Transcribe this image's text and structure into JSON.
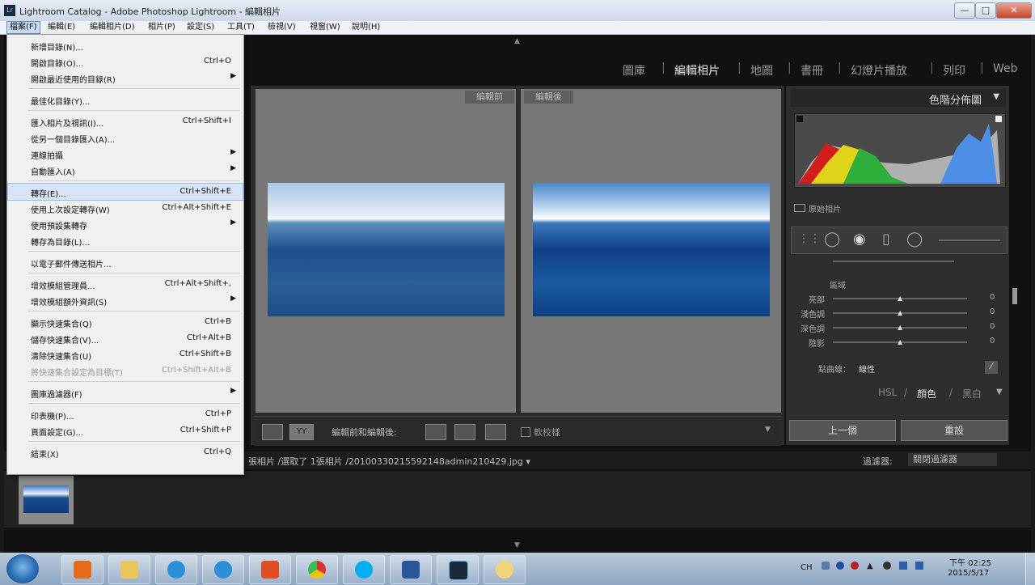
{
  "window": {
    "title": "Lightroom Catalog - Adobe Photoshop Lightroom - 編輯相片",
    "app_icon": "Lr",
    "minimize": "—",
    "maximize": "□",
    "close": "✕"
  },
  "menubar": [
    "檔案(F)",
    "編輯(E)",
    "編輯相片(D)",
    "相片(P)",
    "設定(S)",
    "工具(T)",
    "檢視(V)",
    "視窗(W)",
    "說明(H)"
  ],
  "file_menu": [
    {
      "label": "新增目錄(N)...",
      "shortcut": ""
    },
    {
      "label": "開啟目錄(O)...",
      "shortcut": "Ctrl+O"
    },
    {
      "label": "開啟最近使用的目錄(R)",
      "shortcut": "",
      "submenu": true
    },
    {
      "sep": true
    },
    {
      "label": "最佳化目錄(Y)...",
      "shortcut": ""
    },
    {
      "sep": true
    },
    {
      "label": "匯入相片及視訊(I)...",
      "shortcut": "Ctrl+Shift+I"
    },
    {
      "label": "從另一個目錄匯入(A)...",
      "shortcut": ""
    },
    {
      "label": "連線拍攝",
      "shortcut": "",
      "submenu": true
    },
    {
      "label": "自動匯入(A)",
      "shortcut": "",
      "submenu": true
    },
    {
      "sep": true
    },
    {
      "label": "轉存(E)...",
      "shortcut": "Ctrl+Shift+E",
      "highlight": true
    },
    {
      "label": "使用上次設定轉存(W)",
      "shortcut": "Ctrl+Alt+Shift+E"
    },
    {
      "label": "使用預設集轉存",
      "shortcut": "",
      "submenu": true
    },
    {
      "label": "轉存為目錄(L)...",
      "shortcut": ""
    },
    {
      "sep": true
    },
    {
      "label": "以電子郵件傳送相片...",
      "shortcut": ""
    },
    {
      "sep": true
    },
    {
      "label": "增效模組管理員...",
      "shortcut": "Ctrl+Alt+Shift+,"
    },
    {
      "label": "增效模組額外資訊(S)",
      "shortcut": "",
      "submenu": true
    },
    {
      "sep": true
    },
    {
      "label": "顯示快速集合(Q)",
      "shortcut": "Ctrl+B"
    },
    {
      "label": "儲存快速集合(V)...",
      "shortcut": "Ctrl+Alt+B"
    },
    {
      "label": "清除快速集合(U)",
      "shortcut": "Ctrl+Shift+B"
    },
    {
      "label": "將快速集合設定為目標(T)",
      "shortcut": "Ctrl+Shift+Alt+B",
      "disabled": true
    },
    {
      "sep": true
    },
    {
      "label": "圖庫過濾器(F)",
      "shortcut": "",
      "submenu": true
    },
    {
      "sep": true
    },
    {
      "label": "印表機(P)...",
      "shortcut": "Ctrl+P"
    },
    {
      "label": "頁面設定(G)...",
      "shortcut": "Ctrl+Shift+P"
    },
    {
      "sep": true
    },
    {
      "label": "結束(X)",
      "shortcut": "Ctrl+Q"
    }
  ],
  "modules": [
    "圖庫",
    "編輯相片",
    "地圖",
    "書冊",
    "幻燈片播放",
    "列印",
    "Web"
  ],
  "active_module": "編輯相片",
  "before_label": "編輯前",
  "after_label": "編輯後",
  "toolbar": {
    "compare_label": "編輯前和編輯後:",
    "softproof_label": "軟校樣"
  },
  "histogram": {
    "title": "色階分佈圖",
    "original_photo": "原始相片"
  },
  "tone": {
    "section": "區域",
    "sliders": [
      {
        "label": "亮部",
        "value": "0"
      },
      {
        "label": "淺色調",
        "value": "0"
      },
      {
        "label": "深色調",
        "value": "0"
      },
      {
        "label": "陰影",
        "value": "0"
      }
    ],
    "point_curve_label": "點曲線：",
    "point_curve_value": "線性"
  },
  "hsl_tabs": [
    "HSL",
    "/",
    "顏色",
    "/",
    "黑白"
  ],
  "bottom_buttons": {
    "previous": "上一個",
    "reset": "重設"
  },
  "filmbar": {
    "info": "張相片 /選取了 1張相片 /20100330215592148admin210429.jpg ▾",
    "filter_label": "過濾器:",
    "filter_value": "關閉過濾器"
  },
  "tray": {
    "lang": "CH",
    "time": "下午 02:25",
    "date": "2015/5/17"
  },
  "taskbar_icons": [
    "media-player-icon",
    "file-explorer-icon",
    "internet-explorer-icon",
    "internet-explorer-icon",
    "office-icon",
    "chrome-icon",
    "skype-icon",
    "word-icon",
    "lightroom-icon",
    "paint-icon"
  ]
}
